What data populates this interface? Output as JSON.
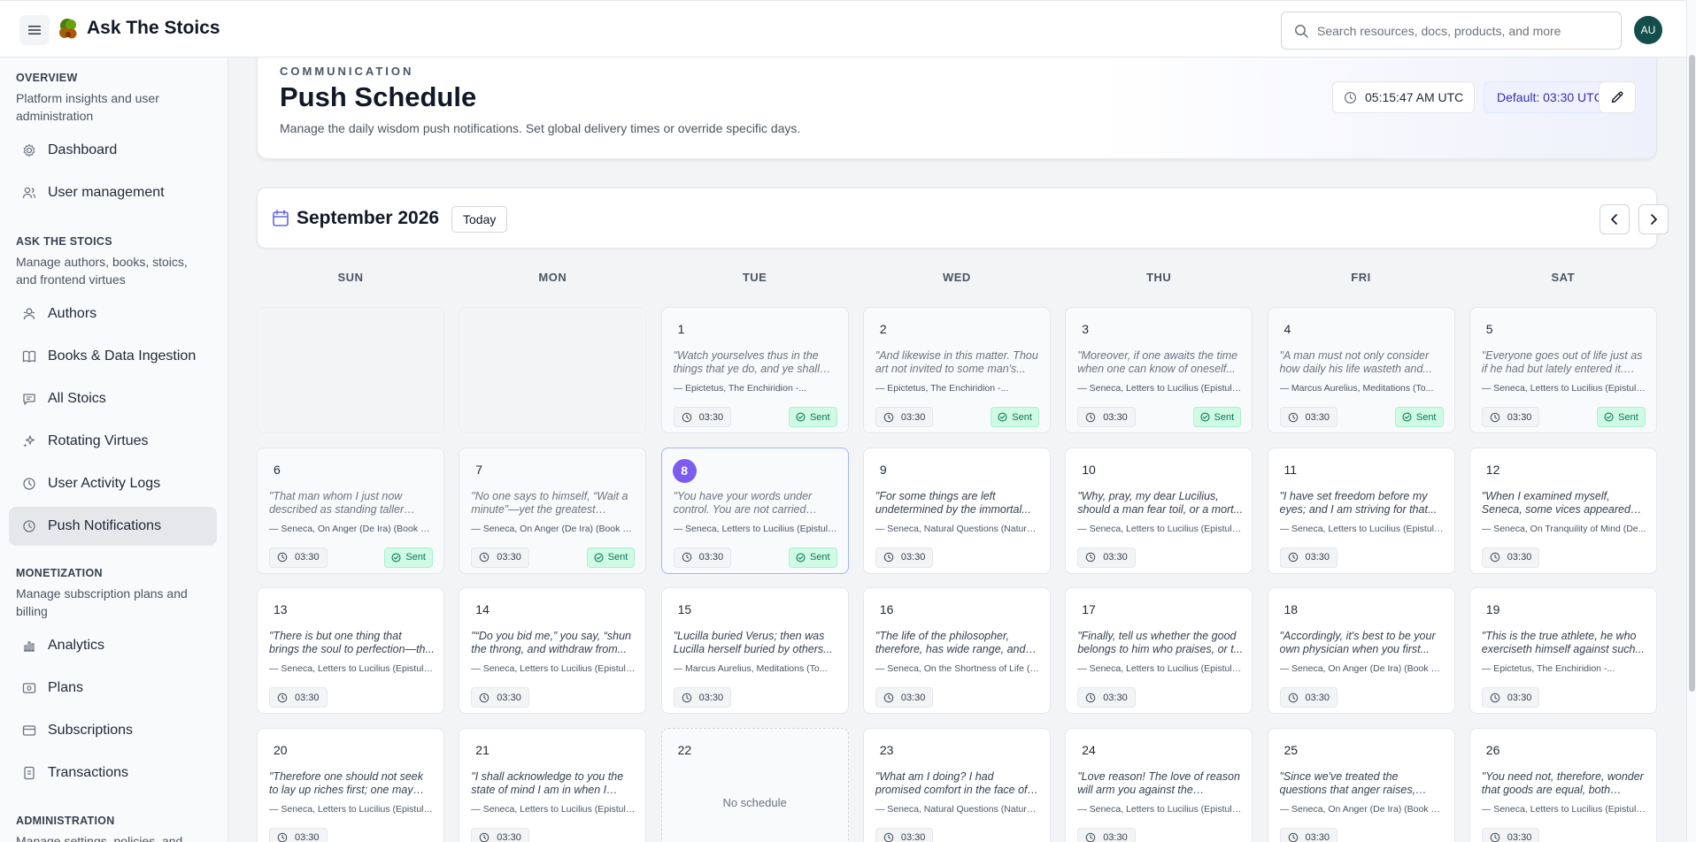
{
  "app": {
    "name": "Ask The Stoics",
    "user_initials": "AU"
  },
  "search": {
    "placeholder": "Search resources, docs, products, and more"
  },
  "sidebar": {
    "sections": [
      {
        "title": "OVERVIEW",
        "desc": "Platform insights and user administration",
        "items": [
          {
            "label": "Dashboard",
            "icon": "gear-icon"
          },
          {
            "label": "User management",
            "icon": "users-icon"
          }
        ]
      },
      {
        "title": "ASK THE STOICS",
        "desc": "Manage authors, books, stoics, and frontend virtues",
        "items": [
          {
            "label": "Authors",
            "icon": "authors-icon"
          },
          {
            "label": "Books & Data Ingestion",
            "icon": "book-icon"
          },
          {
            "label": "All Stoics",
            "icon": "chat-icon"
          },
          {
            "label": "Rotating Virtues",
            "icon": "sparkle-icon"
          },
          {
            "label": "User Activity Logs",
            "icon": "history-icon"
          },
          {
            "label": "Push Notifications",
            "icon": "bell-icon",
            "active": true
          }
        ]
      },
      {
        "title": "MONETIZATION",
        "desc": "Manage subscription plans and billing",
        "items": [
          {
            "label": "Analytics",
            "icon": "chart-icon"
          },
          {
            "label": "Plans",
            "icon": "card-icon"
          },
          {
            "label": "Subscriptions",
            "icon": "list-icon"
          },
          {
            "label": "Transactions",
            "icon": "receipt-icon"
          }
        ]
      },
      {
        "title": "ADMINISTRATION",
        "desc": "Manage settings, policies, and"
      }
    ]
  },
  "header": {
    "overline": "COMMUNICATION",
    "title": "Push Schedule",
    "description": "Manage the daily wisdom push notifications. Set global delivery times or override specific days.",
    "current_time": "05:15:47 AM UTC",
    "default_time": "Default: 03:30 UTC"
  },
  "calendar": {
    "month": "September 2026",
    "today_label": "Today",
    "weekdays": [
      "SUN",
      "MON",
      "TUE",
      "WED",
      "THU",
      "FRI",
      "SAT"
    ],
    "sent_label": "Sent",
    "no_schedule_label": "No schedule",
    "days": [
      {
        "empty": true
      },
      {
        "empty": true
      },
      {
        "day": "1",
        "quote": "\"Watch yourselves thus in the things that ye do, and ye shall see...",
        "source": "— Epictetus, The Enchiridion -...",
        "time": "03:30",
        "status": "sent"
      },
      {
        "day": "2",
        "quote": "\"And likewise in this matter. Thou art not invited to some man's...",
        "source": "— Epictetus, The Enchiridion -...",
        "time": "03:30",
        "status": "sent"
      },
      {
        "day": "3",
        "quote": "\"Moreover, if one awaits the time when one can know of oneself...",
        "source": "— Seneca, Letters to Lucilius (Epistula...",
        "time": "03:30",
        "status": "sent"
      },
      {
        "day": "4",
        "quote": "\"A man must not only consider how daily his life wasteth and...",
        "source": "— Marcus Aurelius, Meditations (To...",
        "time": "03:30",
        "status": "sent"
      },
      {
        "day": "5",
        "quote": "\"Everyone goes out of life just as if he had but lately entered it. Take...",
        "source": "— Seneca, Letters to Lucilius (Epistula...",
        "time": "03:30",
        "status": "sent"
      },
      {
        "day": "6",
        "quote": "\"That man whom I just now described as standing taller than...",
        "source": "— Seneca, On Anger (De Ira) (Book 3,...",
        "time": "03:30",
        "status": "sent"
      },
      {
        "day": "7",
        "quote": "\"No one says to himself, “Wait a minute”—yet the greatest remed...",
        "source": "— Seneca, On Anger (De Ira) (Book 3,...",
        "time": "03:30",
        "status": "sent"
      },
      {
        "day": "8",
        "quote": "\"You have your words under control. You are not carried away...",
        "source": "— Seneca, Letters to Lucilius (Epistula...",
        "time": "03:30",
        "status": "sent",
        "today": true
      },
      {
        "day": "9",
        "quote": "\"For some things are left undetermined by the immortal...",
        "source": "— Seneca, Natural Questions (Naturale...",
        "time": "03:30"
      },
      {
        "day": "10",
        "quote": "\"Why, pray, my dear Lucilius, should a man fear toil, or a mort...",
        "source": "— Seneca, Letters to Lucilius (Epistula...",
        "time": "03:30"
      },
      {
        "day": "11",
        "quote": "\"I have set freedom before my eyes; and I am striving for that...",
        "source": "— Seneca, Letters to Lucilius (Epistula...",
        "time": "03:30"
      },
      {
        "day": "12",
        "quote": "\"When I examined myself, Seneca, some vices appeared so...",
        "source": "— Seneca, On Tranquility of Mind (De...",
        "time": "03:30"
      },
      {
        "day": "13",
        "quote": "\"There is but one thing that brings the soul to perfection—th...",
        "source": "— Seneca, Letters to Lucilius (Epistula...",
        "time": "03:30"
      },
      {
        "day": "14",
        "quote": "\"“Do you bid me,” you say, “shun the throng, and withdraw from...",
        "source": "— Seneca, Letters to Lucilius (Epistula...",
        "time": "03:30"
      },
      {
        "day": "15",
        "quote": "\"Lucilla buried Verus; then was Lucilla herself buried by others...",
        "source": "— Marcus Aurelius, Meditations (To...",
        "time": "03:30"
      },
      {
        "day": "16",
        "quote": "\"The life of the philosopher, therefore, has wide range, and h...",
        "source": "— Seneca, On the Shortness of Life (D...",
        "time": "03:30"
      },
      {
        "day": "17",
        "quote": "\"Finally, tell us whether the good belongs to him who praises, or t...",
        "source": "— Seneca, Letters to Lucilius (Epistula...",
        "time": "03:30"
      },
      {
        "day": "18",
        "quote": "\"Accordingly, it's best to be your own physician when you first...",
        "source": "— Seneca, On Anger (De Ira) (Book 3,...",
        "time": "03:30"
      },
      {
        "day": "19",
        "quote": "\"This is the true athlete, he who exerciseth himself against such...",
        "source": "— Epictetus, The Enchiridion -...",
        "time": "03:30"
      },
      {
        "day": "20",
        "quote": "\"Therefore one should not seek to lay up riches first; one may attai...",
        "source": "— Seneca, Letters to Lucilius (Epistula...",
        "time": "03:30"
      },
      {
        "day": "21",
        "quote": "\"I shall acknowledge to you the state of mind I am in when I read...",
        "source": "— Seneca, Letters to Lucilius (Epistula...",
        "time": "03:30"
      },
      {
        "day": "22",
        "none": true
      },
      {
        "day": "23",
        "quote": "\"What am I doing? I had promised comfort in the face of dangers...",
        "source": "— Seneca, Natural Questions (Naturale...",
        "time": "03:30"
      },
      {
        "day": "24",
        "quote": "\"Love reason! The love of reason will arm you against the greatest...",
        "source": "— Seneca, Letters to Lucilius (Epistula...",
        "time": "03:30"
      },
      {
        "day": "25",
        "quote": "\"Since we've treated the questions that anger raises, let's...",
        "source": "— Seneca, On Anger (De Ira) (Book 3,...",
        "time": "03:30"
      },
      {
        "day": "26",
        "quote": "\"You need not, therefore, wonder that goods are equal, both those...",
        "source": "— Seneca, Letters to Lucilius (Epistula...",
        "time": "03:30"
      }
    ]
  }
}
